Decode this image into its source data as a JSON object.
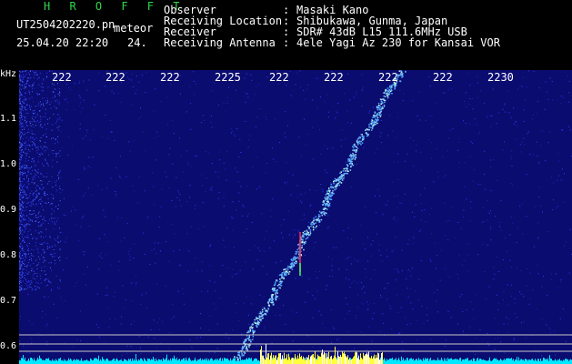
{
  "app": {
    "title": "H R O F F T"
  },
  "file": {
    "name": "UT2504202220.pn",
    "tag": "meteor"
  },
  "capture": {
    "date_time": "25.04.20 22:20",
    "minute": "24."
  },
  "info": [
    {
      "label": "Observer",
      "sep": ":",
      "value": "Masaki Kano"
    },
    {
      "label": "Receiving Location",
      "sep": ":",
      "value": "Shibukawa, Gunma, Japan"
    },
    {
      "label": "Receiver",
      "sep": ":",
      "value": "SDR# 43dB L15 111.6MHz USB"
    },
    {
      "label": "Receiving Antenna",
      "sep": ":",
      "value": "4ele Yagi Az 230 for Kansai VOR"
    }
  ],
  "spectrogram": {
    "y_unit": "kHz",
    "y_ticks": [
      "1.1",
      "1.0",
      "0.9",
      "0.8",
      "0.7",
      "0.6"
    ],
    "x_ticks": [
      "222",
      "222",
      "222",
      "2225",
      "222",
      "222",
      "222",
      "222",
      "2230"
    ],
    "colors": {
      "background": "#0b0c70",
      "trail": "#4fa8ff",
      "noise": "#2d3cff",
      "baseline": "#00e8ff",
      "burst": "#ffff3a",
      "marker": "#ff2a4a",
      "gridline": "#c8c8c8"
    }
  }
}
